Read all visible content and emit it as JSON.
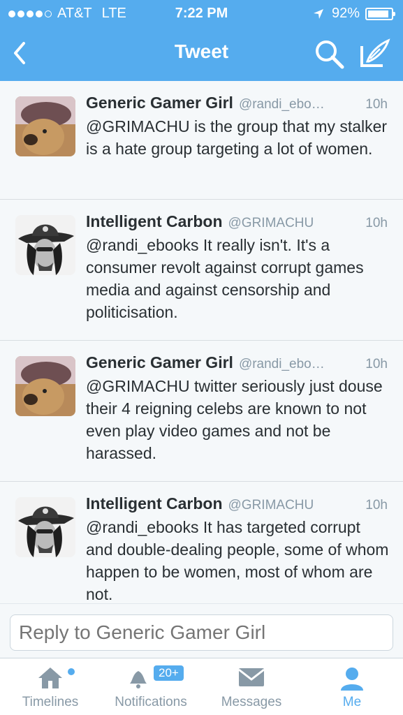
{
  "status_bar": {
    "carrier": "AT&T",
    "network": "LTE",
    "time": "7:22 PM",
    "battery": "92%",
    "battery_level": 0.92
  },
  "nav": {
    "title": "Tweet",
    "icons": [
      "back-chevron-icon",
      "search-icon",
      "compose-icon"
    ]
  },
  "tweets": [
    {
      "name": "Generic Gamer Girl",
      "handle": "@randi_ebo…",
      "time": "10h",
      "text": "@GRIMACHU is the group that my stalker is a hate group targeting a lot of women.",
      "avatar": "dog-avatar"
    },
    {
      "name": "Intelligent Carbon",
      "handle": "@GRIMACHU",
      "time": "10h",
      "text": "@randi_ebooks It really isn't. It's a consumer revolt against corrupt games media and against censorship and politicisation.",
      "avatar": "man-hat-avatar"
    },
    {
      "name": "Generic Gamer Girl",
      "handle": "@randi_ebo…",
      "time": "10h",
      "text": "@GRIMACHU twitter seriously just douse their 4 reigning celebs are known to not even play video games and not be harassed.",
      "avatar": "dog-avatar"
    },
    {
      "name": "Intelligent Carbon",
      "handle": "@GRIMACHU",
      "time": "10h",
      "text": "@randi_ebooks It has targeted corrupt and double-dealing people, some of whom happen to be women, most of whom are not.",
      "avatar": "man-hat-avatar"
    }
  ],
  "reply": {
    "placeholder": "Reply to Generic Gamer Girl"
  },
  "tabs": [
    {
      "label": "Timelines",
      "icon": "home-icon",
      "active": false
    },
    {
      "label": "Notifications",
      "icon": "bell-icon",
      "badge": "20+",
      "active": false
    },
    {
      "label": "Messages",
      "icon": "envelope-icon",
      "active": false
    },
    {
      "label": "Me",
      "icon": "person-icon",
      "active": true
    }
  ],
  "colors": {
    "brand": "#55acee",
    "text": "#292f33",
    "muted": "#8899a6"
  }
}
